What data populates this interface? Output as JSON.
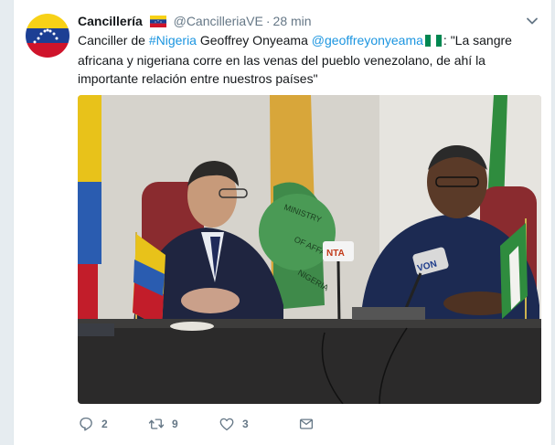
{
  "tweet": {
    "name": "Cancillería",
    "handle": "@CancilleriaVE",
    "separator": "·",
    "time": "28 min",
    "text": {
      "part1": "Canciller de ",
      "hashtag": "#Nigeria",
      "part2": " Geoffrey Onyeama ",
      "mention": "@geoffreyonyeama",
      "part3": ": \"La sangre africana y nigeriana corre en las venas del pueblo venezolano, de ahí la importante relación entre nuestros países\""
    },
    "replies": "2",
    "retweets": "9",
    "likes": "3"
  },
  "icons": {
    "avatar": "venezuela-flag-avatar",
    "name_flag": "venezuela-flag-icon",
    "text_flag": "nigeria-flag-icon",
    "caret": "chevron-down-icon",
    "reply": "reply-icon",
    "retweet": "retweet-icon",
    "like": "heart-icon",
    "dm": "envelope-icon"
  },
  "photo": {
    "mic_labels": [
      "NTA",
      "VON"
    ],
    "banner_text": "MINISTRY OF FOREIGN AFFAIRS NIGERIA"
  },
  "colors": {
    "link": "#1b95e0",
    "text": "#14171a",
    "secondary": "#657786"
  }
}
